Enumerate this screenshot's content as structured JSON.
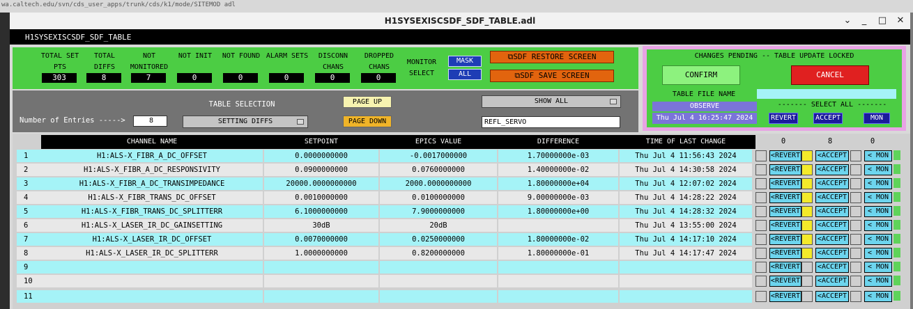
{
  "window": {
    "title": "H1SYSEXISCSDF_SDF_TABLE.adl",
    "app_name": "H1SYSEXISCSDF_SDF_TABLE",
    "bg_text": "wa.caltech.edu/svn/cds_user_apps/trunk/cds/k1/mode/SITEMOD adl"
  },
  "stats": [
    {
      "label": "TOTAL SET PTS",
      "value": "303"
    },
    {
      "label": "TOTAL DIFFS",
      "value": "8"
    },
    {
      "label": "NOT MONITORED",
      "value": "7"
    },
    {
      "label": "NOT INIT",
      "value": "0"
    },
    {
      "label": "NOT FOUND",
      "value": "0"
    },
    {
      "label": "ALARM SETS",
      "value": "0"
    },
    {
      "label": "DISCONN CHANS",
      "value": "0"
    },
    {
      "label": "DROPPED CHANS",
      "value": "0"
    }
  ],
  "monitor": {
    "label": "MONITOR SELECT",
    "mask": "MASK",
    "all": "ALL"
  },
  "actions": {
    "restore": "SDF RESTORE SCREEN",
    "save": "SDF SAVE SCREEN"
  },
  "pending": {
    "header": "CHANGES PENDING -- TABLE UPDATE LOCKED",
    "confirm": "CONFIRM",
    "cancel": "CANCEL",
    "file_label": "TABLE FILE NAME",
    "file_value": "",
    "observe": "OBSERVE",
    "timestamp": "Thu Jul  4 16:25:47 2024",
    "select_all": "------- SELECT ALL -------",
    "revert": "REVERT",
    "accept": "ACCEPT",
    "mon": "MON"
  },
  "selection": {
    "entries_label": "Number of Entries ----->",
    "entries_value": "8",
    "table_selection_label": "TABLE SELECTION",
    "table_selection_value": "SETTING DIFFS",
    "page_up": "PAGE UP",
    "page_down": "PAGE DOWN",
    "filter_value": "SHOW ALL",
    "search_value": "REFL_SERVO"
  },
  "table": {
    "headers": [
      "CHANNEL NAME",
      "SETPOINT",
      "EPICS VALUE",
      "DIFFERENCE",
      "TIME OF LAST CHANGE"
    ],
    "counts": [
      "0",
      "8",
      "0"
    ],
    "revert_label": "<REVERT",
    "accept_label": "<ACCEPT",
    "mon_label": "< MON",
    "rows": [
      {
        "n": "1",
        "channel": "H1:ALS-X_FIBR_A_DC_OFFSET",
        "setpoint": "0.0000000000",
        "epics": "-0.0017000000",
        "diff": "1.70000000e-03",
        "time": "Thu Jul  4 11:56:43 2024"
      },
      {
        "n": "2",
        "channel": "H1:ALS-X_FIBR_A_DC_RESPONSIVITY",
        "setpoint": "0.0900000000",
        "epics": "0.0760000000",
        "diff": "1.40000000e-02",
        "time": "Thu Jul  4 14:30:58 2024"
      },
      {
        "n": "3",
        "channel": "H1:ALS-X_FIBR_A_DC_TRANSIMPEDANCE",
        "setpoint": "20000.0000000000",
        "epics": "2000.0000000000",
        "diff": "1.80000000e+04",
        "time": "Thu Jul  4 12:07:02 2024"
      },
      {
        "n": "4",
        "channel": "H1:ALS-X_FIBR_TRANS_DC_OFFSET",
        "setpoint": "0.0010000000",
        "epics": "0.0100000000",
        "diff": "9.00000000e-03",
        "time": "Thu Jul  4 14:28:22 2024"
      },
      {
        "n": "5",
        "channel": "H1:ALS-X_FIBR_TRANS_DC_SPLITTERR",
        "setpoint": "6.1000000000",
        "epics": "7.9000000000",
        "diff": "1.80000000e+00",
        "time": "Thu Jul  4 14:28:32 2024"
      },
      {
        "n": "6",
        "channel": "H1:ALS-X_LASER_IR_DC_GAINSETTING",
        "setpoint": "30dB",
        "epics": "20dB",
        "diff": "",
        "time": "Thu Jul  4 13:55:00 2024"
      },
      {
        "n": "7",
        "channel": "H1:ALS-X_LASER_IR_DC_OFFSET",
        "setpoint": "0.0070000000",
        "epics": "0.0250000000",
        "diff": "1.80000000e-02",
        "time": "Thu Jul  4 14:17:10 2024"
      },
      {
        "n": "8",
        "channel": "H1:ALS-X_LASER_IR_DC_SPLITTERR",
        "setpoint": "1.0000000000",
        "epics": "0.8200000000",
        "diff": "1.80000000e-01",
        "time": "Thu Jul  4 14:17:47 2024"
      },
      {
        "n": "9",
        "channel": "",
        "setpoint": "",
        "epics": "",
        "diff": "",
        "time": ""
      },
      {
        "n": "10",
        "channel": "",
        "setpoint": "",
        "epics": "",
        "diff": "",
        "time": ""
      },
      {
        "n": "11",
        "channel": "",
        "setpoint": "",
        "epics": "",
        "diff": "",
        "time": ""
      }
    ]
  },
  "colors": {
    "panel_green": "#4ccd44",
    "row_cyan": "#a5f3f7",
    "row_gray": "#e8e8e8",
    "accept_yellow": "#f4ea2a",
    "pending_border": "#e7a3e4"
  }
}
